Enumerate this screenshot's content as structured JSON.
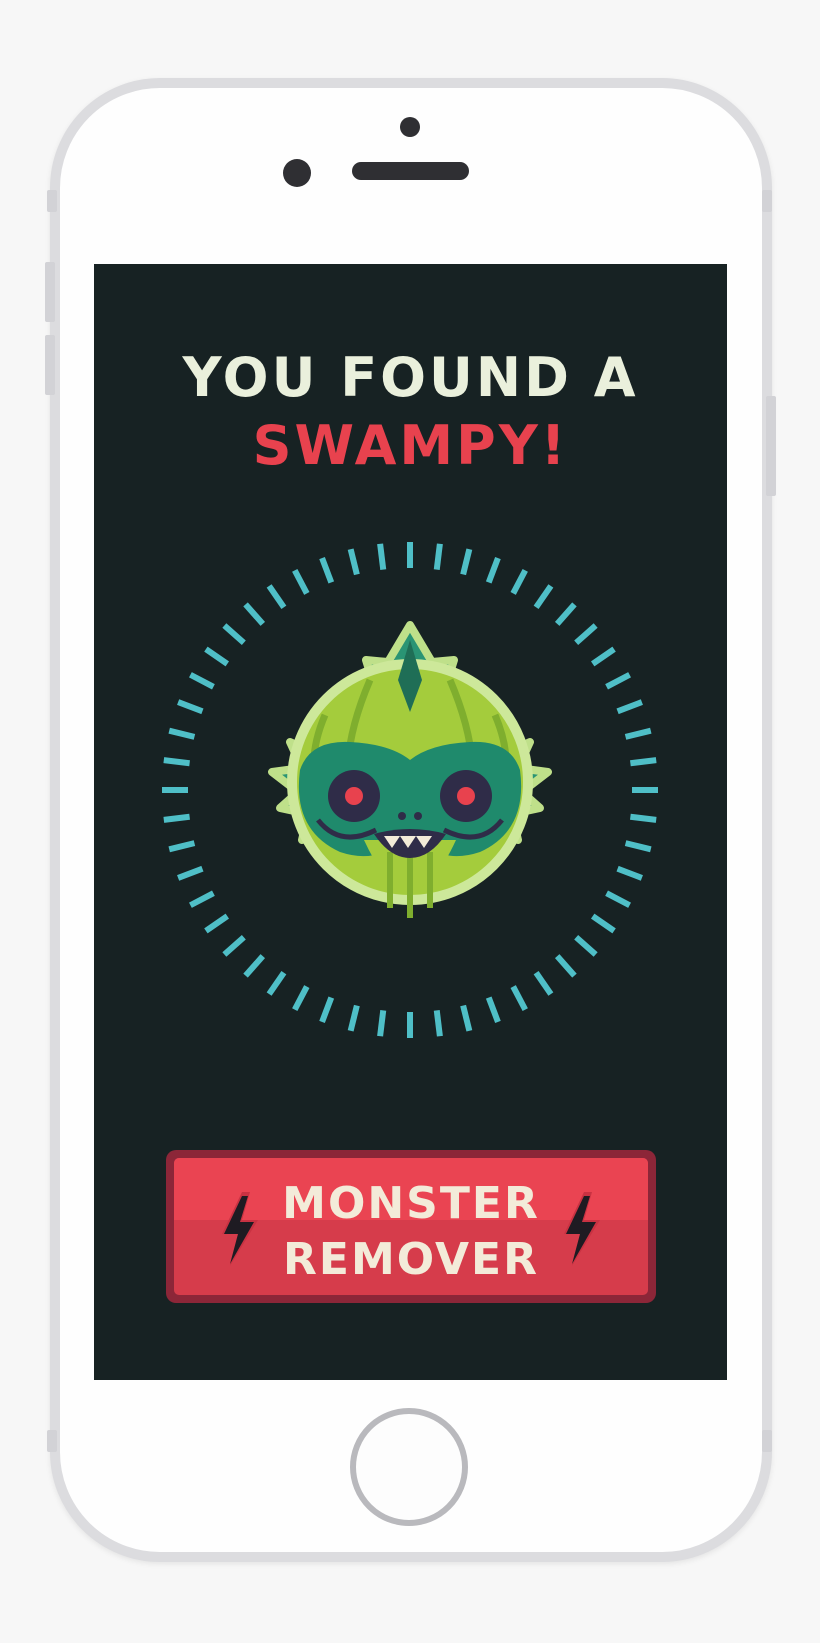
{
  "screen": {
    "title_line1": "YOU FOUND A",
    "title_line2": "SWAMPY!",
    "monster_icon": "swamp-monster-icon",
    "button": {
      "line1": "MONSTER",
      "line2": "REMOVER",
      "icon_left": "lightning-bolt-icon",
      "icon_right": "lightning-bolt-icon"
    }
  },
  "colors": {
    "screen_bg": "#172223",
    "title_primary": "#eaf0dc",
    "title_accent": "#e8424e",
    "ring_ticks": "#4fbfc7",
    "button_red": "#ea4452",
    "button_border": "#8c2638",
    "monster_light_green": "#a4cc3c",
    "monster_dark_green": "#1f8a6c"
  }
}
